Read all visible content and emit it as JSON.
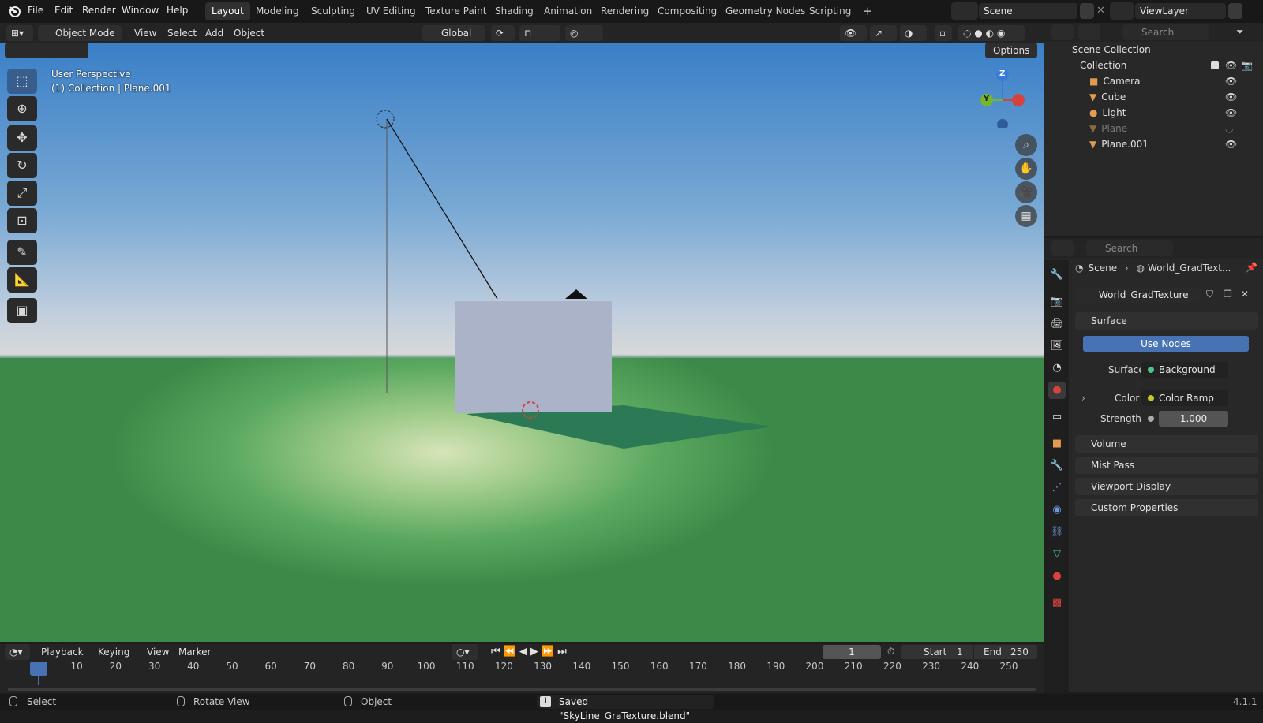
{
  "menu": [
    "File",
    "Edit",
    "Render",
    "Window",
    "Help"
  ],
  "workspaces": [
    "Layout",
    "Modeling",
    "Sculpting",
    "UV Editing",
    "Texture Paint",
    "Shading",
    "Animation",
    "Rendering",
    "Compositing",
    "Geometry Nodes",
    "Scripting"
  ],
  "active_workspace": "Layout",
  "scene_name": "Scene",
  "view_layer": "ViewLayer",
  "viewport_header": {
    "mode": "Object Mode",
    "view": "View",
    "select": "Select",
    "add": "Add",
    "object": "Object",
    "transform_orientation": "Global",
    "options": "Options"
  },
  "viewport": {
    "perspective": "User Perspective",
    "context": "(1) Collection | Plane.001"
  },
  "gizmo": {
    "z": "Z",
    "y": "Y"
  },
  "outliner": {
    "search_placeholder": "Search",
    "root": "Scene Collection",
    "collection": "Collection",
    "items": [
      {
        "name": "Camera",
        "icon": "camera-icon"
      },
      {
        "name": "Cube",
        "icon": "mesh-icon"
      },
      {
        "name": "Light",
        "icon": "light-icon"
      },
      {
        "name": "Plane",
        "icon": "mesh-icon",
        "hidden": true
      },
      {
        "name": "Plane.001",
        "icon": "mesh-icon",
        "selected": true
      }
    ]
  },
  "properties": {
    "search_placeholder": "Search",
    "breadcrumb_scene": "Scene",
    "breadcrumb_world": "World_GradText...",
    "world_name": "World_GradTexture",
    "panel_surface": "Surface",
    "use_nodes": "Use Nodes",
    "surface_label": "Surface",
    "surface_value": "Background",
    "color_label": "Color",
    "color_value": "Color Ramp",
    "strength_label": "Strength",
    "strength_value": "1.000",
    "panels": [
      "Volume",
      "Mist Pass",
      "Viewport Display",
      "Custom Properties"
    ]
  },
  "timeline": {
    "playback": "Playback",
    "keying": "Keying",
    "view": "View",
    "marker": "Marker",
    "current_frame": "1",
    "start_label": "Start",
    "start_value": "1",
    "end_label": "End",
    "end_value": "250",
    "ticks": [
      "1",
      "10",
      "20",
      "30",
      "40",
      "50",
      "60",
      "70",
      "80",
      "90",
      "100",
      "110",
      "120",
      "130",
      "140",
      "150",
      "160",
      "170",
      "180",
      "190",
      "200",
      "210",
      "220",
      "230",
      "240",
      "250"
    ]
  },
  "status": {
    "select": "Select",
    "rotate": "Rotate View",
    "object": "Object",
    "message": "Saved \"SkyLine_GraTexture.blend\"",
    "version": "4.1.1"
  },
  "colors": {
    "accent": "#4772b3",
    "ground": "#3c8a4c",
    "sky": "#3a7fc7"
  }
}
